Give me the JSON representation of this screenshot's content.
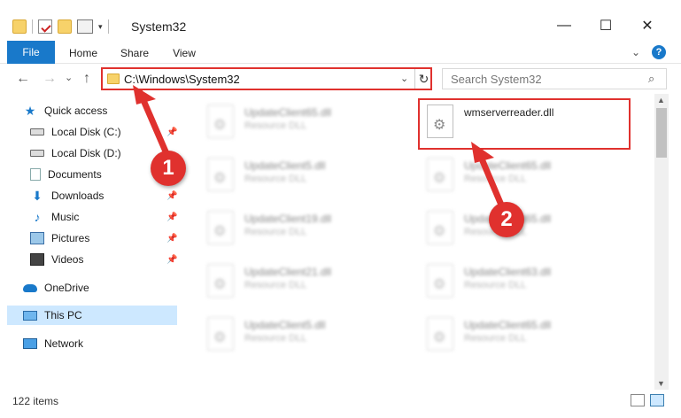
{
  "window": {
    "title": "System32",
    "min_icon": "minimize-icon",
    "max_icon": "maximize-icon",
    "close_icon": "close-icon"
  },
  "ribbon": {
    "tabs": [
      "File",
      "Home",
      "Share",
      "View"
    ],
    "accent": "#1979ca"
  },
  "navigation": {
    "back": "←",
    "forward": "→",
    "recent": "⌄",
    "up": "↑",
    "address": "C:\\Windows\\System32",
    "search_placeholder": "Search System32"
  },
  "sidebar": {
    "items": [
      {
        "label": "Quick access",
        "icon": "star-icon"
      },
      {
        "label": "Local Disk (C:)",
        "icon": "disk-icon",
        "pinned": true
      },
      {
        "label": "Local Disk (D:)",
        "icon": "disk-icon"
      },
      {
        "label": "Documents",
        "icon": "documents-icon",
        "pinned": true
      },
      {
        "label": "Downloads",
        "icon": "downloads-icon",
        "pinned": true
      },
      {
        "label": "Music",
        "icon": "music-icon",
        "pinned": true
      },
      {
        "label": "Pictures",
        "icon": "pictures-icon",
        "pinned": true
      },
      {
        "label": "Videos",
        "icon": "videos-icon",
        "pinned": true
      },
      {
        "label": "OneDrive",
        "icon": "onedrive-icon"
      },
      {
        "label": "This PC",
        "icon": "this-pc-icon",
        "selected": true
      },
      {
        "label": "Network",
        "icon": "network-icon"
      }
    ]
  },
  "files": {
    "highlighted": {
      "name": "wmserverreader.dll",
      "description": ""
    },
    "left_column": [
      {
        "name": "UpdateClient65.dll",
        "description": "Resource DLL"
      },
      {
        "name": "UpdateClient5.dll",
        "description": "Resource DLL"
      },
      {
        "name": "UpdateClient19.dll",
        "description": "Resource DLL"
      },
      {
        "name": "UpdateClient21.dll",
        "description": "Resource DLL"
      },
      {
        "name": "UpdateClient5.dll",
        "description": "Resource DLL"
      }
    ],
    "right_column": [
      {
        "name": "UpdateClient65.dll",
        "description": "Resource DLL"
      },
      {
        "name": "UpdateClient65.dll",
        "description": "Resource DLL"
      },
      {
        "name": "UpdateClient63.dll",
        "description": "Resource DLL"
      },
      {
        "name": "UpdateClient65.dll",
        "description": "Resource DLL"
      }
    ]
  },
  "status": {
    "item_count": "122 items"
  },
  "annotations": {
    "step1": "1",
    "step2": "2",
    "color": "#e0312e"
  }
}
